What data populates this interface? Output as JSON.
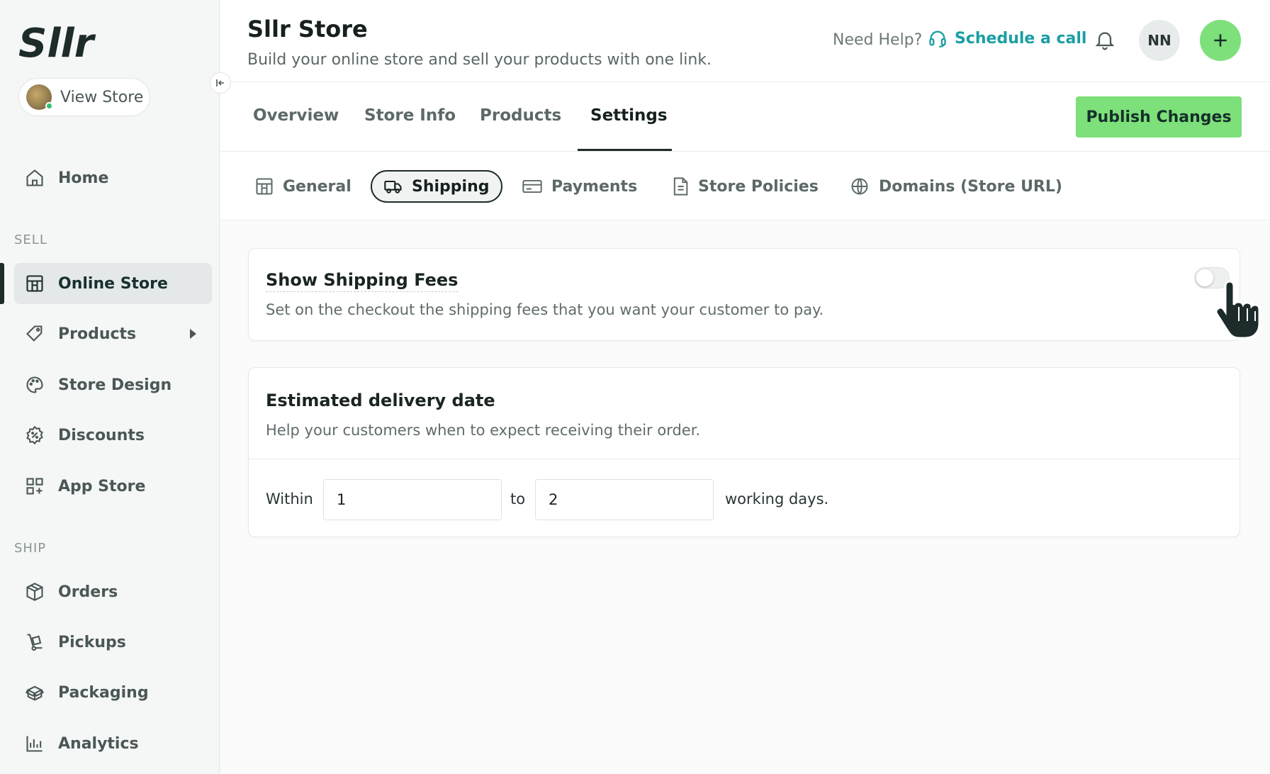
{
  "brand": {
    "logo_text": "Sllr"
  },
  "sidebar": {
    "view_store": "View Store",
    "home": "Home",
    "sell_label": "SELL",
    "ship_label": "SHIP",
    "items": {
      "online_store": "Online Store",
      "products": "Products",
      "store_design": "Store Design",
      "discounts": "Discounts",
      "app_store": "App Store",
      "orders": "Orders",
      "pickups": "Pickups",
      "packaging": "Packaging",
      "analytics": "Analytics"
    }
  },
  "header": {
    "title": "Sllr Store",
    "subtitle": "Build your online store and sell your products with one link.",
    "need_help": "Need Help?",
    "schedule_call": "Schedule a call",
    "user_initials": "NN"
  },
  "tabs": {
    "overview": "Overview",
    "store_info": "Store Info",
    "products": "Products",
    "settings": "Settings",
    "publish": "Publish Changes"
  },
  "subtabs": {
    "general": "General",
    "shipping": "Shipping",
    "payments": "Payments",
    "store_policies": "Store Policies",
    "domains": "Domains (Store URL)"
  },
  "shipping_fees": {
    "title": "Show Shipping Fees",
    "description": "Set on the checkout the shipping fees that you want your customer to pay.",
    "enabled": false
  },
  "delivery": {
    "title": "Estimated delivery date",
    "description": "Help your customers when to expect receiving their order.",
    "within_label": "Within",
    "min_days": "1",
    "to_label": "to",
    "max_days": "2",
    "suffix": "working days."
  },
  "colors": {
    "accent_green": "#7de07a",
    "link_teal": "#1a9ea4",
    "dark": "#1f2b2a"
  }
}
